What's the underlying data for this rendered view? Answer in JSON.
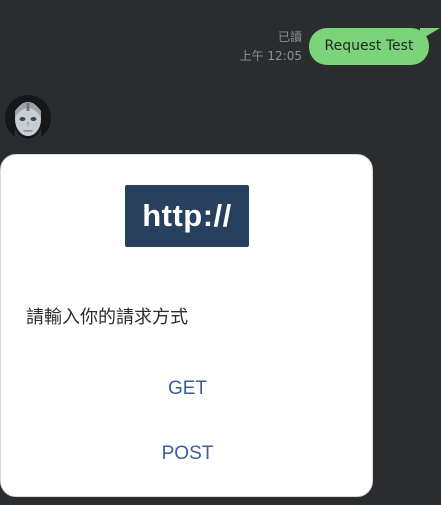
{
  "outgoing_message": {
    "text": "Request Test",
    "read_status": "已讀",
    "time": "上午 12:05",
    "bubble_color": "#7bd37a"
  },
  "incoming": {
    "avatar_icon": "robot-avatar-icon",
    "card": {
      "logo_text": "http://",
      "logo_color": "#26405d",
      "prompt": "請輸入你的請求方式",
      "actions": [
        {
          "label": "GET"
        },
        {
          "label": "POST"
        }
      ],
      "action_color": "#3a5ea0"
    }
  },
  "background_color": "#2b2c2e"
}
